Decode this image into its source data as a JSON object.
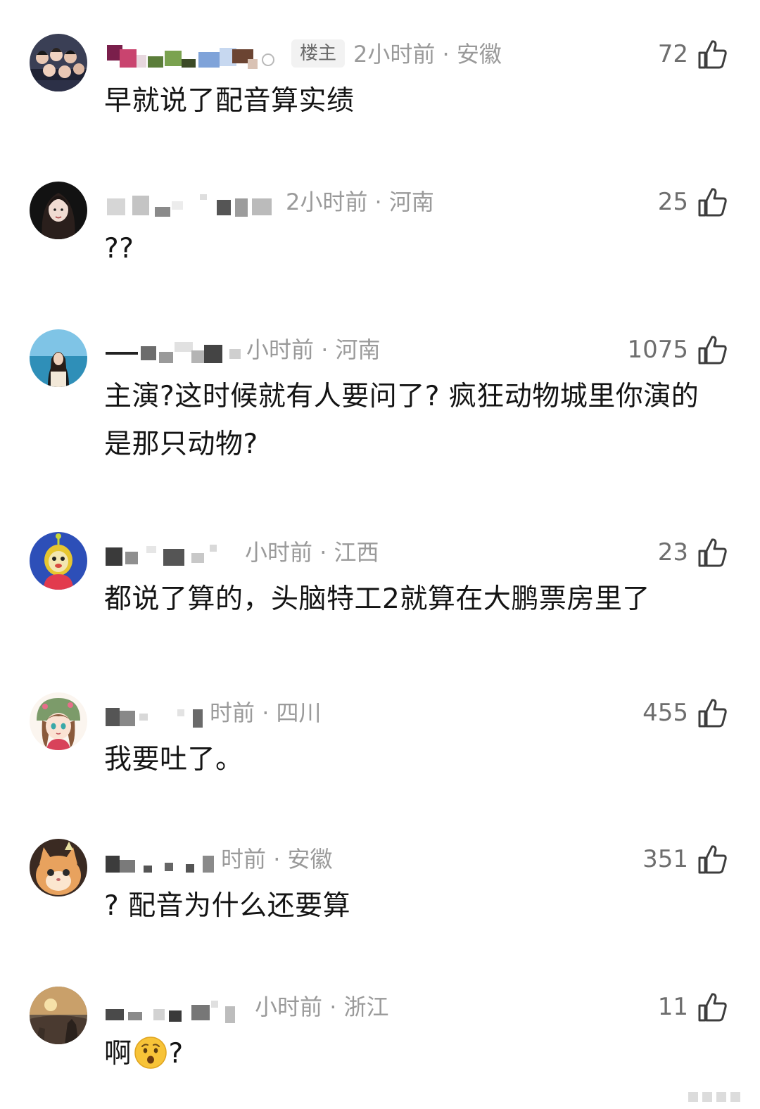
{
  "comments": [
    {
      "badge": "楼主",
      "time": "2小时前",
      "region": "安徽",
      "likes": "72",
      "text": "早就说了配音算实绩"
    },
    {
      "time": "2小时前",
      "region": "河南",
      "likes": "25",
      "text": "??"
    },
    {
      "time": "小时前",
      "region": "河南",
      "likes": "1075",
      "text": "主演?这时候就有人要问了? 疯狂动物城里你演的是那只动物?"
    },
    {
      "time": "小时前",
      "region": "江西",
      "likes": "23",
      "text": "都说了算的，头脑特工2就算在大鹏票房里了"
    },
    {
      "time": "时前",
      "region": "四川",
      "likes": "455",
      "text": "我要吐了。"
    },
    {
      "time": "时前",
      "region": "安徽",
      "likes": "351",
      "text": "? 配音为什么还要算"
    },
    {
      "time": "小时前",
      "region": "浙江",
      "likes": "11",
      "text_before": "啊",
      "emoji": "astonished-face-emoji",
      "text_after": "?"
    }
  ],
  "colors": {
    "meta": "#9a9a9a",
    "likes": "#6e6e6e",
    "text": "#141414",
    "badge_bg": "#f2f2f2"
  },
  "icons": {
    "like": "thumbs-up-icon"
  }
}
